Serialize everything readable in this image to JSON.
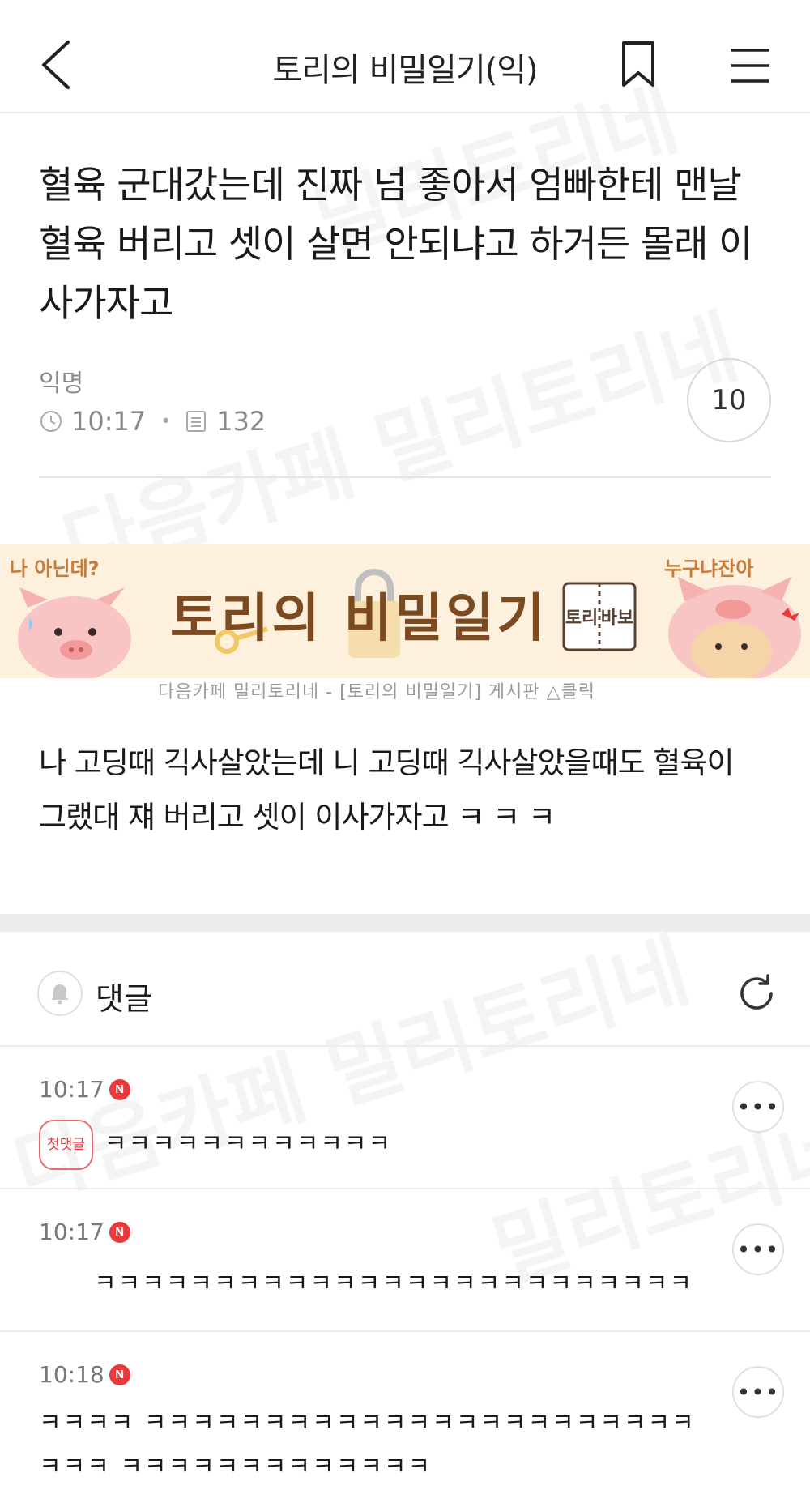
{
  "header": {
    "title": "토리의 비밀일기(익)"
  },
  "article": {
    "title": "혈육 군대갔는데 진짜 넘 좋아서 엄빠한테 맨날 혈육 버리고 셋이 살면 안되냐고 하거든 몰래 이사가자고",
    "author": "익명",
    "time": "10:17",
    "views": "132",
    "comment_count": "10",
    "body": "나 고딩때 긱사살았는데 니 고딩때 긱사살았을때도 혈육이 그랬대 쟤 버리고 셋이 이사가자고 ㅋ ㅋ ㅋ"
  },
  "banner": {
    "left_text": "나 아닌데?",
    "right_text": "누구냐잔아",
    "title": "토리의 비밀일기",
    "book_text": "토리 바보",
    "caption": "다음카페 밀리토리네 - [토리의 비밀일기] 게시판 △클릭"
  },
  "comments_section": {
    "label": "댓글"
  },
  "comments": [
    {
      "time": "10:17",
      "new_badge": "N",
      "first_label": "첫댓글",
      "text": "ㅋㅋㅋㅋㅋㅋㅋㅋㅋㅋㅋㅋ"
    },
    {
      "time": "10:17",
      "new_badge": "N",
      "text": "ㅋㅋㅋㅋㅋㅋㅋㅋㅋㅋㅋㅋㅋㅋㅋㅋㅋㅋㅋㅋㅋㅋㅋㅋㅋ"
    },
    {
      "time": "10:18",
      "new_badge": "N",
      "text": "ㅋㅋㅋㅋ ㅋㅋㅋㅋㅋㅋㅋㅋㅋㅋㅋㅋㅋㅋㅋㅋㅋㅋㅋㅋㅋㅋㅋㅋㅋㅋ ㅋㅋㅋㅋㅋㅋㅋㅋㅋㅋㅋㅋㅋ"
    }
  ],
  "more_glyph": "•••",
  "watermark": {
    "text_a": "다음카페 밀리토리네",
    "text_b": "밀리토리네"
  },
  "colors": {
    "accent_red": "#e83a3a",
    "banner_bg": "#fdf0dc"
  }
}
